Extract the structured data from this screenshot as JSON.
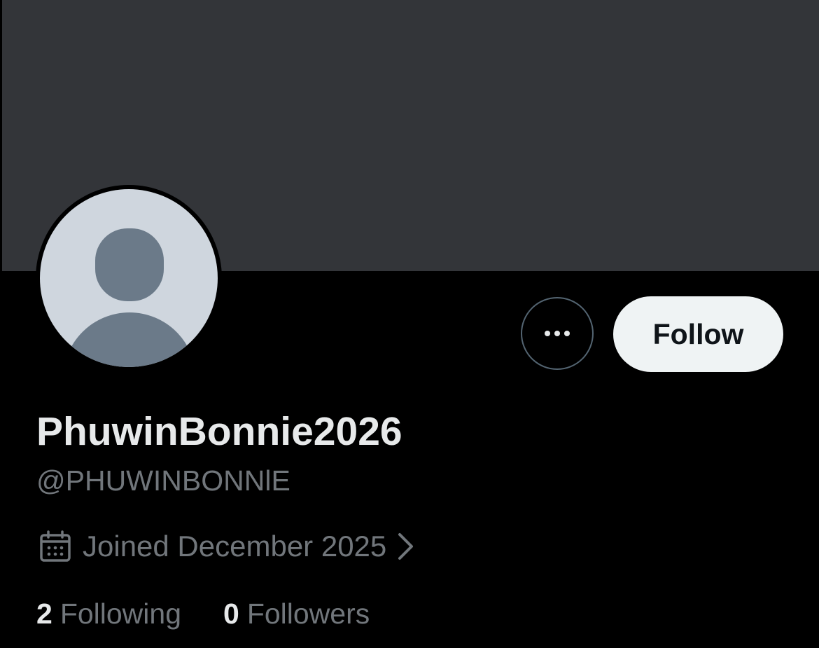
{
  "profile": {
    "display_name": "PhuwinBonnie2026",
    "handle": "@PHUWINBONNlE",
    "joined": "Joined December 2025",
    "avatar_icon": "default-avatar-icon"
  },
  "actions": {
    "more_icon": "more-dots-icon",
    "follow_label": "Follow"
  },
  "stats": {
    "following_count": "2",
    "following_label": "Following",
    "followers_count": "0",
    "followers_label": "Followers"
  },
  "colors": {
    "background": "#000000",
    "banner": "#333539",
    "avatar_bg": "#cfd6de",
    "avatar_silhouette": "#6b7a89",
    "primary_text": "#e7e9ea",
    "secondary_text": "#71767b",
    "follow_button_bg": "#eff3f4",
    "follow_button_text": "#0f1419"
  }
}
